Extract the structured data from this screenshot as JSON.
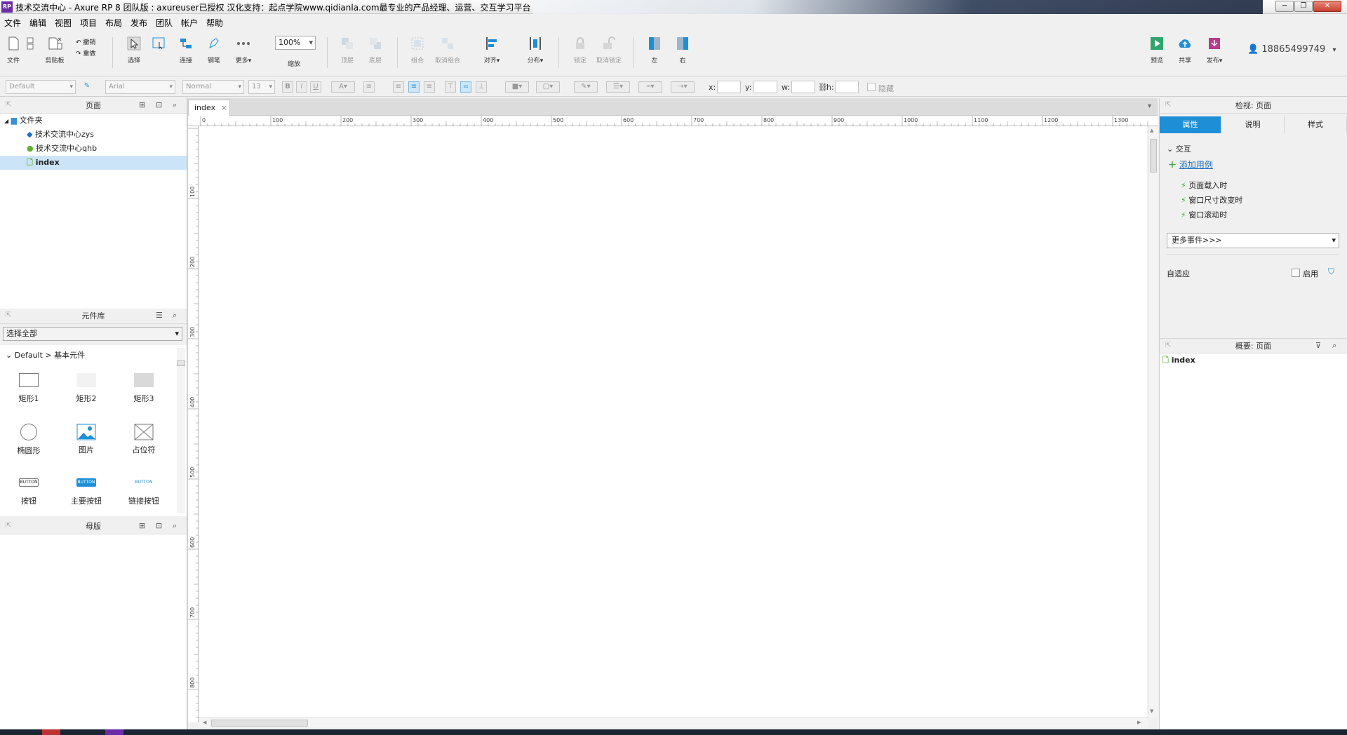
{
  "titlebar": {
    "logo": "RP",
    "title": "技术交流中心 - Axure RP 8 团队版 : axureuser已授权 汉化支持：起点学院www.qidianla.com最专业的产品经理、运营、交互学习平台",
    "minimize": "─",
    "restore": "❐",
    "close": "✕"
  },
  "menu": [
    "文件",
    "编辑",
    "视图",
    "项目",
    "布局",
    "发布",
    "团队",
    "帐户",
    "帮助"
  ],
  "toolbar": {
    "file": "文件",
    "clipboard": "剪贴板",
    "undo": "撤销",
    "redo": "重做",
    "select": "选择",
    "connect": "连接",
    "pen": "钢笔",
    "more": "更多▾",
    "zoom_value": "100%",
    "zoom_label": "缩放",
    "top": "顶层",
    "bottom": "底层",
    "group": "组合",
    "ungroup": "取消组合",
    "align": "对齐▾",
    "distribute": "分布▾",
    "lock": "锁定",
    "unlock": "取消锁定",
    "left": "左",
    "right": "右",
    "preview": "预览",
    "share": "共享",
    "publish": "发布▾",
    "user": "18865499749"
  },
  "formatbar": {
    "style": "Default",
    "font": "Arial",
    "weight": "Normal",
    "size": "13",
    "x_label": "x:",
    "y_label": "y:",
    "w_label": "w:",
    "h_label": "h:",
    "hidden_label": "隐藏"
  },
  "pages_panel": {
    "title": "页面",
    "folder": "文件夹",
    "items": [
      "技术交流中心zys",
      "技术交流中心qhb",
      "index"
    ]
  },
  "library_panel": {
    "title": "元件库",
    "select_all": "选择全部",
    "section": "Default > 基本元件",
    "widgets": [
      "矩形1",
      "矩形2",
      "矩形3",
      "椭圆形",
      "图片",
      "占位符",
      "按钮",
      "主要按钮",
      "链接按钮"
    ],
    "button_text": "BUTTON"
  },
  "masters_panel": {
    "title": "母版"
  },
  "canvas": {
    "tab": "index",
    "h_ticks": [
      "0",
      "100",
      "200",
      "300",
      "400",
      "500",
      "600",
      "700",
      "800",
      "900",
      "1000",
      "1100",
      "1200",
      "1300"
    ],
    "v_ticks": [
      "100",
      "200",
      "300",
      "400",
      "500",
      "600",
      "700",
      "800"
    ]
  },
  "inspector": {
    "title": "检视: 页面",
    "tabs": [
      "属性",
      "说明",
      "样式"
    ],
    "interaction_header": "交互",
    "add_case": "添加用例",
    "events": [
      "页面载入时",
      "窗口尺寸改变时",
      "窗口滚动时"
    ],
    "more_events": "更多事件>>>",
    "adaptive": "自适应",
    "enable": "启用"
  },
  "outline": {
    "title": "概要: 页面",
    "item": "index"
  },
  "colors": {
    "accent": "#1e8fd6",
    "selected_row": "#cce4f7",
    "axure_purple": "#6c2ca8"
  }
}
